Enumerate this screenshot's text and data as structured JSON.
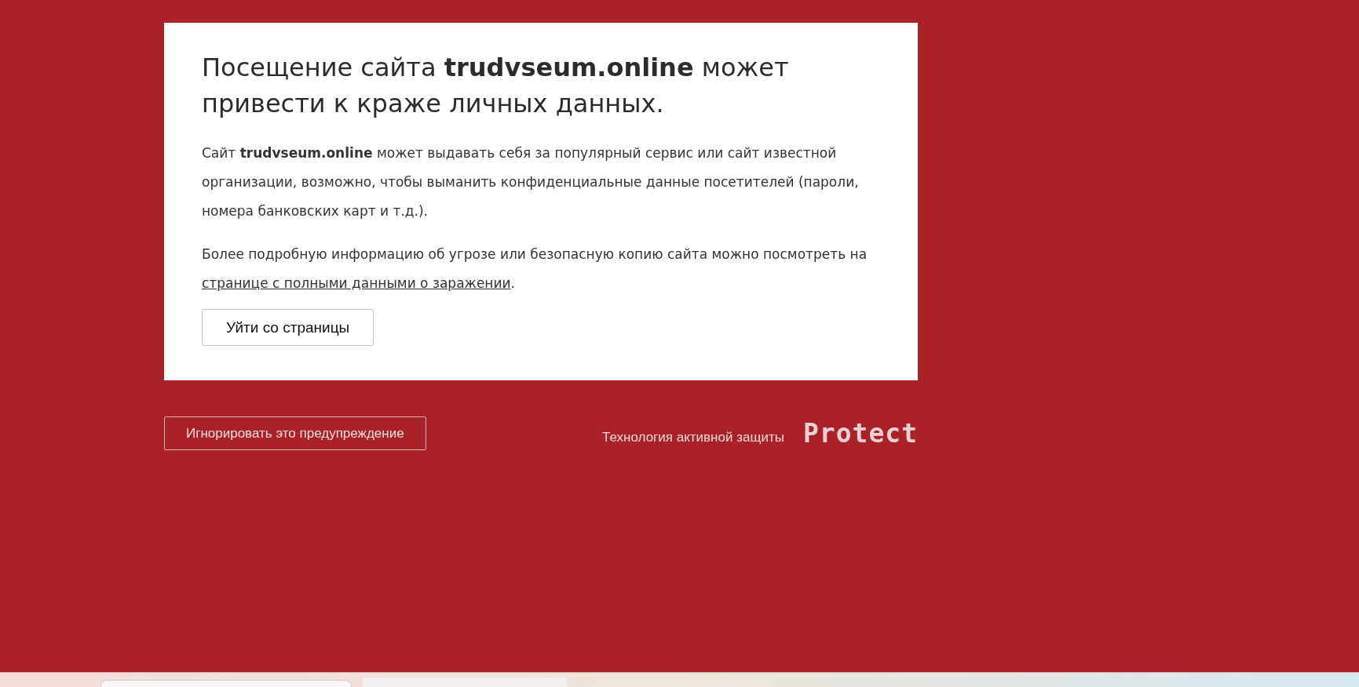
{
  "warning": {
    "heading": "Посещение сайта **trudvseum.online** может привести к краже личных данных.",
    "paragraph": "Сайт **trudvseum.online** может выдавать себя за популярный сервис или сайт известной организации, возможно, чтобы выманить конфиденциальные данные посетителей (пароли, номера банковских карт и т.д.).",
    "details": {
      "before": "Более подробную информацию об угрозе или безопасную копию сайта можно посмотреть на ",
      "link": "странице с полными данными о заражении",
      "after": "."
    },
    "leave_button": "Уйти со страницы"
  },
  "footer": {
    "ignore_button": "Игнорировать это предупреждение",
    "tagline": "Технология активной защиты",
    "logo": "Protect"
  }
}
